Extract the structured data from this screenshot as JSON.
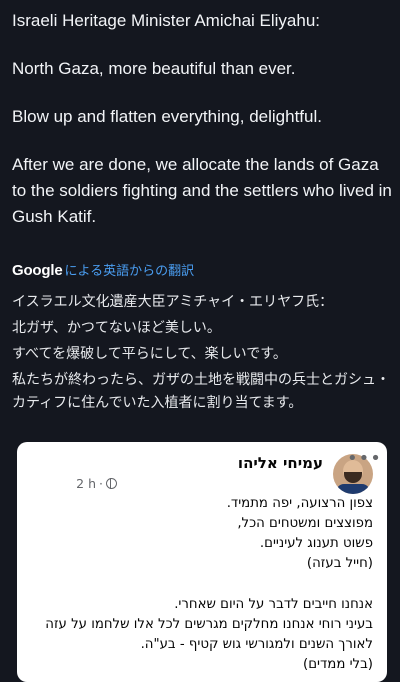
{
  "post": {
    "paragraphs": [
      "Israeli Heritage Minister Amichai Eliyahu:",
      "North Gaza, more beautiful than ever.",
      "Blow up and flatten everything, delightful.",
      "After we are done, we allocate the lands of Gaza to the soldiers fighting and the settlers who lived in Gush Katif."
    ]
  },
  "translation": {
    "google_label": "Google",
    "link_text": "による英語からの翻訳",
    "lines": [
      "イスラエル文化遺産大臣アミチャイ・エリヤフ氏：",
      "北ガザ、かつてないほど美しい。",
      "すべてを爆破して平らにして、楽しいです。",
      "私たちが終わったら、ガザの土地を戦闘中の兵士とガシュ・カティフに住んでいた入植者に割り当てます。"
    ]
  },
  "embedded_post": {
    "author": "עמיחי אליהו",
    "time": "2 h",
    "separator": "·",
    "more": "•••",
    "icons": {
      "avatar": "avatar-image",
      "audience": "globe-icon",
      "more": "more-icon"
    },
    "block1": [
      "צפון הרצועה, יפה מתמיד.",
      "מפוצצים ומשטחים הכל,",
      "פשוט תענוג לעיניים.",
      "(חייל בעזה)"
    ],
    "block2": [
      "אנחנו חייבים לדבר על היום שאחרי.",
      "בעיני רוחי אנחנו מחלקים מגרשים לכל אלו שלחמו על עזה",
      "לאורך השנים ולמגורשי גוש קטיף - בע\"ה.",
      "(בלי ממדים)"
    ]
  }
}
